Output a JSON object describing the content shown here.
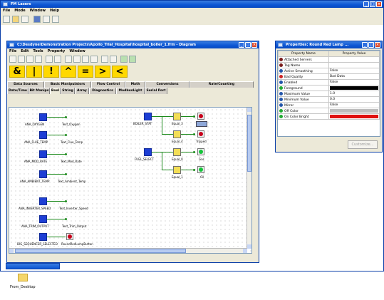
{
  "main_window": {
    "title": "FM Lasers",
    "menu": [
      "File",
      "Mode",
      "Window",
      "Help"
    ]
  },
  "diagram_window": {
    "title": "C:\\Desdyne\\Demonstration Projects\\Apollo_Trial_Hospital\\hospital_boiler_1.frm - Diagram",
    "menu": [
      "File",
      "Edit",
      "Tools",
      "Property",
      "Window"
    ],
    "symbols": [
      "&",
      "|",
      "!",
      "^",
      "=",
      ">",
      "<"
    ],
    "tabs_row1": [
      "Data Sources",
      "Basic Manipulators",
      "Flow Control",
      "Math",
      "Conversions",
      "Rate/Counting"
    ],
    "tabs_row2": [
      "Date/Time",
      "Bit Manips",
      "Bool",
      "String",
      "Array",
      "Diagnostics",
      "ModbusLight",
      "Serial Port"
    ],
    "active_tab": "Bool"
  },
  "diagram": {
    "inputs": [
      {
        "name": "ANA_OXYGEN",
        "tag": "Text_Oxygen"
      },
      {
        "name": "ANA_FLUE_TEMP",
        "tag": "Text_Flue_Temp"
      },
      {
        "name": "ANA_MOD_RATE",
        "tag": "Text_Mod_Rate"
      },
      {
        "name": "ANA_AMBIENT_TEMP",
        "tag": "Text_Ambient_Temp"
      },
      {
        "name": "ANA_INVERTER_SPEED",
        "tag": "Text_Inverter_Speed"
      },
      {
        "name": "ANA_TRIM_OUTPUT",
        "tag": "Text_Trim_Output"
      },
      {
        "name": "DIG_SEQUENCER_SELECTED",
        "tag": "RoundRedLampButton"
      }
    ],
    "boiler_stat": "BOILER_STAT",
    "fuel_select": "FUEL_SELECT",
    "gates": [
      "Equal_3",
      "Equal_4",
      "Equal_0",
      "Equal_1"
    ],
    "outputs": [
      "Tripped",
      "Gas",
      "Oil"
    ]
  },
  "properties_window": {
    "title": "Properties: Round Red Lamp ...",
    "col_name": "Property Name",
    "col_value": "Property Value",
    "rows": [
      {
        "name": "Attached Servers",
        "value": "",
        "icon_color": "#7a1c1c"
      },
      {
        "name": "Tag Name",
        "value": "",
        "icon_color": "#7a1c1c"
      },
      {
        "name": "Active Smoothing",
        "value": "False",
        "icon_color": "#2255aa"
      },
      {
        "name": "Bad Quality",
        "value": "Bad Data",
        "icon_color": "#cc2222"
      },
      {
        "name": "Enabled",
        "value": "False",
        "icon_color": "#2255aa"
      },
      {
        "name": "Foreground",
        "value": "",
        "icon_color": "#22aa33",
        "swatch": "#000000"
      },
      {
        "name": "Maximum Value",
        "value": "1.0",
        "icon_color": "#2255aa"
      },
      {
        "name": "Minimum Value",
        "value": "0.0",
        "icon_color": "#2255aa"
      },
      {
        "name": "Mirror",
        "value": "False",
        "icon_color": "#2255aa"
      },
      {
        "name": "Off Color",
        "value": "",
        "icon_color": "#22aa33",
        "swatch": "#bdbdbd"
      },
      {
        "name": "On Color Bright",
        "value": "",
        "icon_color": "#22aa33",
        "swatch": "#e01010"
      }
    ],
    "button": "Customize..."
  },
  "desktop": {
    "folder_label": "From_Desktop"
  }
}
